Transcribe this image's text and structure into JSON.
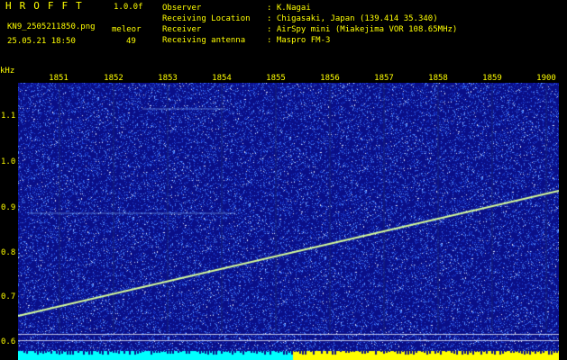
{
  "header": {
    "logo": "HROFFT",
    "version": "1.0.0f",
    "filename": "KN9_2505211850.png",
    "datetime": "25.05.21 18:50",
    "station_label": "meleor",
    "count": "49",
    "labels": [
      "Observer",
      "Receiving Location",
      "Receiver",
      "Receiving antenna"
    ],
    "values": [
      ": K.Nagai",
      ": Chigasaki, Japan (139.414 35.340)",
      ": AirSpy mini (Miakejima VOR 108.65MHz)",
      ": Maspro FM-3"
    ]
  },
  "axis": {
    "unit": "kHz",
    "x_ticks": [
      "1851",
      "1852",
      "1853",
      "1854",
      "1855",
      "1856",
      "1857",
      "1858",
      "1859",
      "1900"
    ],
    "y_ticks": [
      "1.1",
      "1.0",
      "0.9",
      "0.8",
      "0.7",
      "0.6"
    ]
  },
  "colors": {
    "background": "#0a0f88",
    "text": "#ffff00",
    "signal": "#ffff80",
    "noise": "#3a7bff",
    "band": "#00ffff"
  }
}
